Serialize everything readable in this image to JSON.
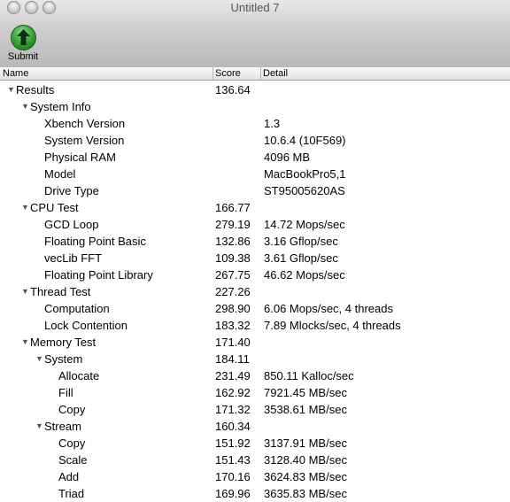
{
  "window": {
    "title": "Untitled 7"
  },
  "toolbar": {
    "submit_label": "Submit",
    "submit_icon": "up-arrow-icon"
  },
  "columns": {
    "name": "Name",
    "score": "Score",
    "detail": "Detail"
  },
  "rows": [
    {
      "level": 0,
      "expanded": true,
      "name": "Results",
      "score": "136.64",
      "detail": ""
    },
    {
      "level": 1,
      "expanded": true,
      "name": "System Info",
      "score": "",
      "detail": ""
    },
    {
      "level": 2,
      "expanded": null,
      "name": "Xbench Version",
      "score": "",
      "detail": "1.3"
    },
    {
      "level": 2,
      "expanded": null,
      "name": "System Version",
      "score": "",
      "detail": "10.6.4 (10F569)"
    },
    {
      "level": 2,
      "expanded": null,
      "name": "Physical RAM",
      "score": "",
      "detail": "4096 MB"
    },
    {
      "level": 2,
      "expanded": null,
      "name": "Model",
      "score": "",
      "detail": "MacBookPro5,1"
    },
    {
      "level": 2,
      "expanded": null,
      "name": "Drive Type",
      "score": "",
      "detail": "ST95005620AS"
    },
    {
      "level": 1,
      "expanded": true,
      "name": "CPU Test",
      "score": "166.77",
      "detail": ""
    },
    {
      "level": 2,
      "expanded": null,
      "name": "GCD Loop",
      "score": "279.19",
      "detail": "14.72 Mops/sec"
    },
    {
      "level": 2,
      "expanded": null,
      "name": "Floating Point Basic",
      "score": "132.86",
      "detail": "3.16 Gflop/sec"
    },
    {
      "level": 2,
      "expanded": null,
      "name": "vecLib FFT",
      "score": "109.38",
      "detail": "3.61 Gflop/sec"
    },
    {
      "level": 2,
      "expanded": null,
      "name": "Floating Point Library",
      "score": "267.75",
      "detail": "46.62 Mops/sec"
    },
    {
      "level": 1,
      "expanded": true,
      "name": "Thread Test",
      "score": "227.26",
      "detail": ""
    },
    {
      "level": 2,
      "expanded": null,
      "name": "Computation",
      "score": "298.90",
      "detail": "6.06 Mops/sec, 4 threads"
    },
    {
      "level": 2,
      "expanded": null,
      "name": "Lock Contention",
      "score": "183.32",
      "detail": "7.89 Mlocks/sec, 4 threads"
    },
    {
      "level": 1,
      "expanded": true,
      "name": "Memory Test",
      "score": "171.40",
      "detail": ""
    },
    {
      "level": 2,
      "expanded": true,
      "name": "System",
      "score": "184.11",
      "detail": ""
    },
    {
      "level": 3,
      "expanded": null,
      "name": "Allocate",
      "score": "231.49",
      "detail": "850.11 Kalloc/sec"
    },
    {
      "level": 3,
      "expanded": null,
      "name": "Fill",
      "score": "162.92",
      "detail": "7921.45 MB/sec"
    },
    {
      "level": 3,
      "expanded": null,
      "name": "Copy",
      "score": "171.32",
      "detail": "3538.61 MB/sec"
    },
    {
      "level": 2,
      "expanded": true,
      "name": "Stream",
      "score": "160.34",
      "detail": ""
    },
    {
      "level": 3,
      "expanded": null,
      "name": "Copy",
      "score": "151.92",
      "detail": "3137.91 MB/sec"
    },
    {
      "level": 3,
      "expanded": null,
      "name": "Scale",
      "score": "151.43",
      "detail": "3128.40 MB/sec"
    },
    {
      "level": 3,
      "expanded": null,
      "name": "Add",
      "score": "170.16",
      "detail": "3624.83 MB/sec"
    },
    {
      "level": 3,
      "expanded": null,
      "name": "Triad",
      "score": "169.96",
      "detail": "3635.83 MB/sec"
    }
  ]
}
